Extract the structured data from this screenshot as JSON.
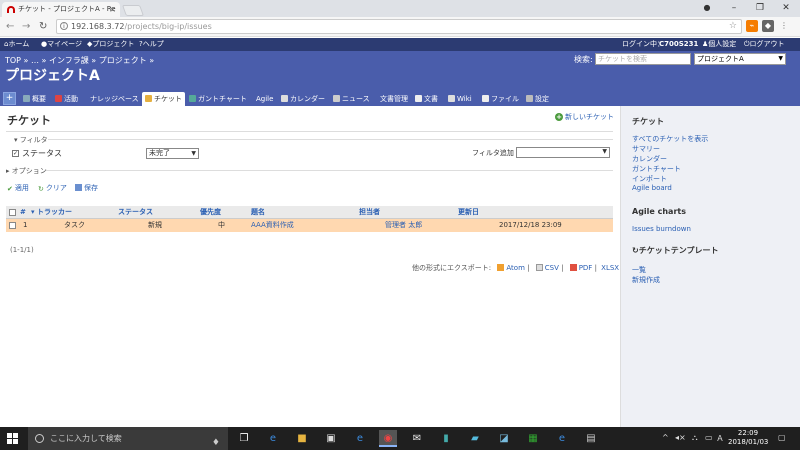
{
  "browser": {
    "tab_title": "チケット - プロジェクトA - Re",
    "url_host": "192.168.3.72",
    "url_path": "/projects/big-ip/issues"
  },
  "topmenu": {
    "home": "ホーム",
    "mypage": "マイページ",
    "projects": "プロジェクト",
    "help": "ヘルプ",
    "logged_in_label": "ログイン中：",
    "user": "C700S231",
    "my_account": "個人設定",
    "logout": "ログアウト"
  },
  "header": {
    "breadcrumb": "TOP » … » インフラ課 » プロジェクト »",
    "project_title": "プロジェクトA",
    "search_label": "検索:",
    "search_placeholder": "チケットを検索",
    "project_select": "プロジェクトA"
  },
  "main_tabs": {
    "plus": "+",
    "overview": "概要",
    "activity": "活動",
    "knowledge": "ナレッジベース",
    "issues": "チケット",
    "gantt": "ガントチャート",
    "agile": "Agile",
    "calendar": "カレンダー",
    "news": "ニュース",
    "documents": "文書管理",
    "docs": "文書",
    "wiki": "Wiki",
    "files": "ファイル",
    "settings": "設定"
  },
  "content": {
    "heading": "チケット",
    "new_issue": "新しいチケット",
    "filter_legend": "フィルタ",
    "status_label": "ステータス",
    "status_value": "未完了",
    "filter_add_label": "フィルタ追加",
    "options_legend": "オプション",
    "apply": "適用",
    "clear": "クリア",
    "save": "保存",
    "pagination": "(1-1/1)",
    "export_label": "他の形式にエクスポート:",
    "export_atom": "Atom",
    "export_csv": "CSV",
    "export_pdf": "PDF",
    "export_xlsx": "XLSX",
    "separator": "|"
  },
  "table": {
    "columns": {
      "id": "#",
      "tracker": "トラッカー",
      "status": "ステータス",
      "priority": "優先度",
      "subject": "題名",
      "assignee": "担当者",
      "updated": "更新日"
    },
    "rows": [
      {
        "id": "1",
        "tracker": "タスク",
        "status": "新規",
        "priority": "中",
        "subject": "AAA資料作成",
        "assignee": "管理者 太郎",
        "updated": "2017/12/18 23:09"
      }
    ]
  },
  "sidebar": {
    "issues_heading": "チケット",
    "links": [
      "すべてのチケットを表示",
      "サマリー",
      "カレンダー",
      "ガントチャート",
      "インポート",
      "Agile board"
    ],
    "agile_heading": "Agile charts",
    "agile_link": "Issues burndown",
    "template_heading": "チケットテンプレート",
    "template_links": [
      "一覧",
      "新規作成"
    ]
  },
  "taskbar": {
    "search_placeholder": "ここに入力して検索",
    "time": "22:09",
    "date": "2018/01/03"
  },
  "colors": {
    "topmenu": "#2c3b72",
    "header": "#4a5dab",
    "row_highlight": "#ffd8b0",
    "link": "#2a5fb3"
  }
}
